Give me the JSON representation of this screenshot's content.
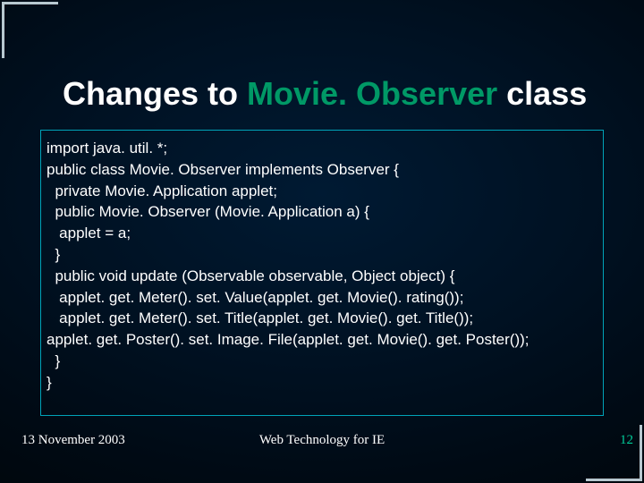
{
  "title": {
    "part1": "Changes to ",
    "part2": "Movie. Observer",
    "part3": " class"
  },
  "code": [
    "import java. util. *;",
    "public class Movie. Observer implements Observer {",
    "  private Movie. Application applet;",
    "  public Movie. Observer (Movie. Application a) {",
    "   applet = a;",
    "  }",
    "  public void update (Observable observable, Object object) {",
    "   applet. get. Meter(). set. Value(applet. get. Movie(). rating());",
    "   applet. get. Meter(). set. Title(applet. get. Movie(). get. Title());",
    "applet. get. Poster(). set. Image. File(applet. get. Movie(). get. Poster());",
    "  }",
    "}"
  ],
  "footer": {
    "date": "13 November 2003",
    "center": "Web Technology for IE",
    "page": "12"
  }
}
